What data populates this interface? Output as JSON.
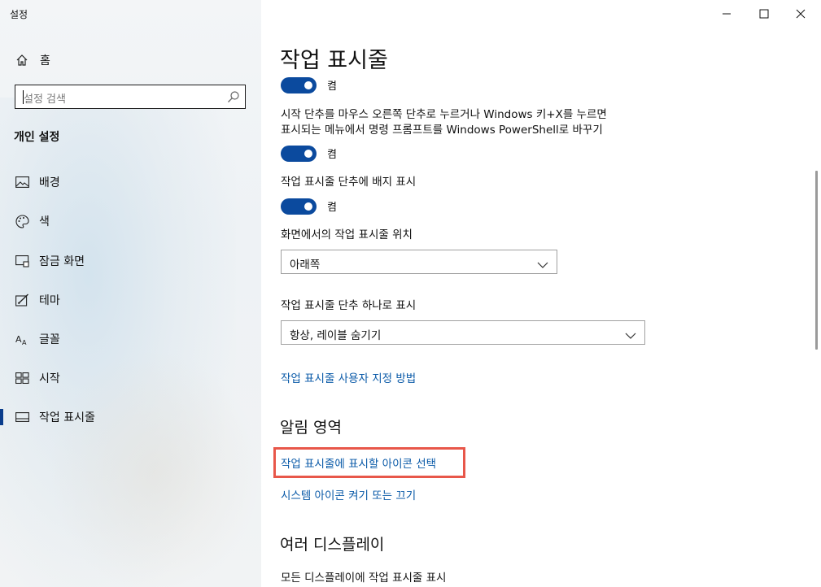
{
  "window": {
    "app_title": "설정",
    "controls": {
      "minimize": "minimize",
      "maximize": "maximize",
      "close": "close"
    }
  },
  "sidebar": {
    "home_label": "홈",
    "search_placeholder": "설정 검색",
    "section_title": "개인 설정",
    "items": [
      {
        "label": "배경",
        "icon": "image-icon"
      },
      {
        "label": "색",
        "icon": "palette-icon"
      },
      {
        "label": "잠금 화면",
        "icon": "lock-screen-icon"
      },
      {
        "label": "테마",
        "icon": "theme-icon"
      },
      {
        "label": "글꼴",
        "icon": "font-icon"
      },
      {
        "label": "시작",
        "icon": "start-icon"
      },
      {
        "label": "작업 표시줄",
        "icon": "taskbar-icon",
        "active": true
      }
    ]
  },
  "main": {
    "page_title": "작업 표시줄",
    "toggle1_state": "켬",
    "option2_label_line1": "시작 단추를 마우스 오른쪽 단추로 누르거나 Windows 키+X를 누르면",
    "option2_label_line2": "표시되는 메뉴에서 명령 프롬프트를 Windows PowerShell로 바꾸기",
    "toggle2_state": "켬",
    "option3_label": "작업 표시줄 단추에 배지 표시",
    "toggle3_state": "켬",
    "position_label": "화면에서의 작업 표시줄 위치",
    "position_value": "아래쪽",
    "combine_label": "작업 표시줄 단추 하나로 표시",
    "combine_value": "항상, 레이블 숨기기",
    "customize_link": "작업 표시줄 사용자 지정 방법",
    "notification_heading": "알림 영역",
    "select_icons_link": "작업 표시줄에 표시할 아이콘 선택",
    "system_icons_link": "시스템 아이콘 켜기 또는 끄기",
    "multi_display_heading": "여러 디스플레이",
    "multi_display_label": "모든 디스플레이에 작업 표시줄 표시"
  },
  "colors": {
    "accent": "#0b4a9e",
    "link": "#0a5aa8",
    "highlight": "#e8574a"
  }
}
